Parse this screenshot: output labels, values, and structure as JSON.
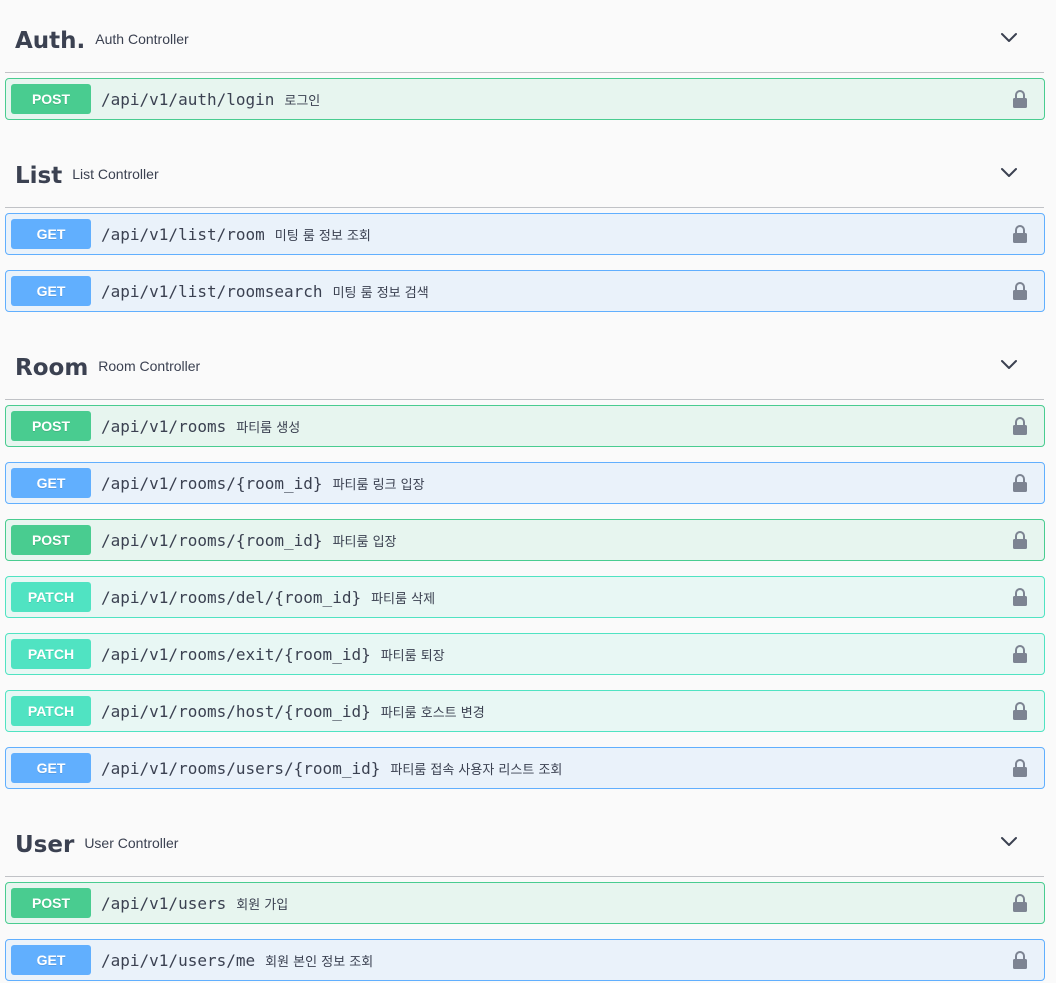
{
  "sections": [
    {
      "name": "Auth.",
      "description": "Auth Controller",
      "operations": [
        {
          "method": "POST",
          "path": "/api/v1/auth/login",
          "summary": "로그인"
        }
      ]
    },
    {
      "name": "List",
      "description": "List Controller",
      "operations": [
        {
          "method": "GET",
          "path": "/api/v1/list/room",
          "summary": "미팅 룸 정보 조회"
        },
        {
          "method": "GET",
          "path": "/api/v1/list/roomsearch",
          "summary": "미팅 룸 정보 검색"
        }
      ]
    },
    {
      "name": "Room",
      "description": "Room Controller",
      "operations": [
        {
          "method": "POST",
          "path": "/api/v1/rooms",
          "summary": "파티룸 생성"
        },
        {
          "method": "GET",
          "path": "/api/v1/rooms/{room_id}",
          "summary": "파티룸 링크 입장"
        },
        {
          "method": "POST",
          "path": "/api/v1/rooms/{room_id}",
          "summary": "파티룸 입장"
        },
        {
          "method": "PATCH",
          "path": "/api/v1/rooms/del/{room_id}",
          "summary": "파티룸 삭제"
        },
        {
          "method": "PATCH",
          "path": "/api/v1/rooms/exit/{room_id}",
          "summary": "파티룸 퇴장"
        },
        {
          "method": "PATCH",
          "path": "/api/v1/rooms/host/{room_id}",
          "summary": "파티룸 호스트 변경"
        },
        {
          "method": "GET",
          "path": "/api/v1/rooms/users/{room_id}",
          "summary": "파티룸 접속 사용자 리스트 조회"
        }
      ]
    },
    {
      "name": "User",
      "description": "User Controller",
      "operations": [
        {
          "method": "POST",
          "path": "/api/v1/users",
          "summary": "회원 가입"
        },
        {
          "method": "GET",
          "path": "/api/v1/users/me",
          "summary": "회원 본인 정보 조회"
        }
      ]
    }
  ],
  "icons": {
    "chevron": "chevron-down-icon",
    "lock": "lock-icon"
  },
  "colors": {
    "post": "#49cc90",
    "get": "#61affe",
    "patch": "#50e3c2",
    "text": "#3b4151",
    "lock": "#7d8492"
  }
}
